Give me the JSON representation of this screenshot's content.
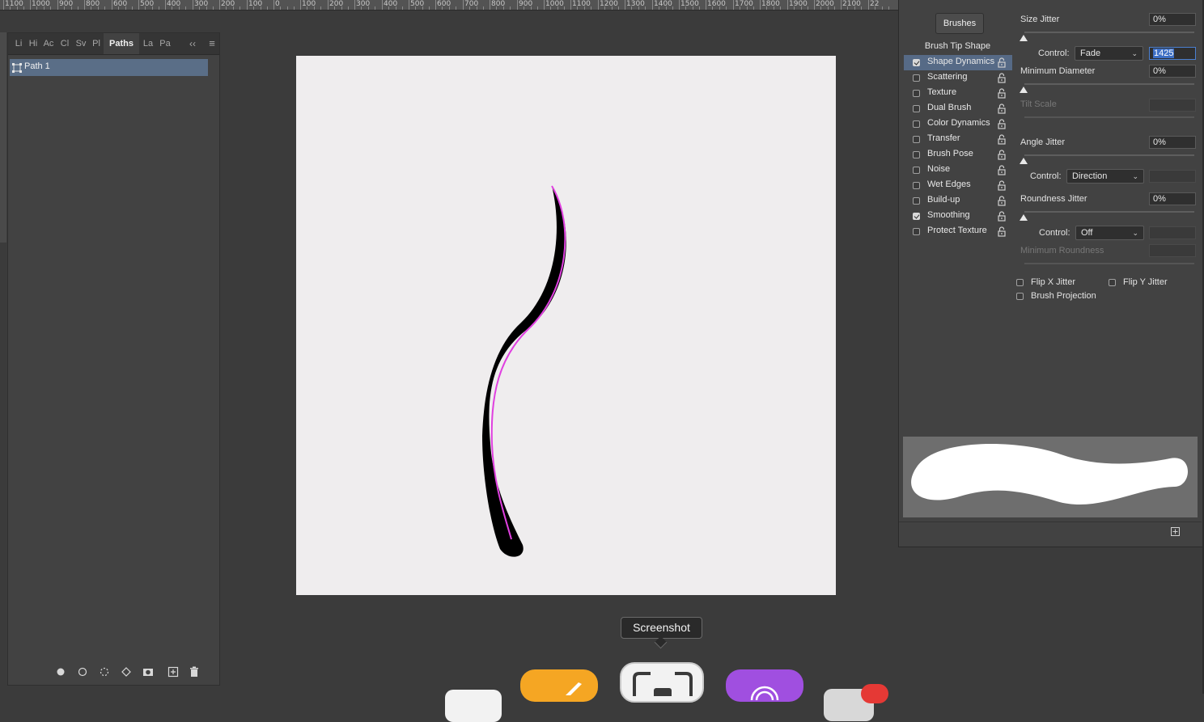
{
  "ruler": {
    "labels": [
      "1100",
      "1000",
      "900",
      "800",
      "600",
      "500",
      "400",
      "300",
      "200",
      "100",
      "0",
      "100",
      "200",
      "300",
      "400",
      "500",
      "600",
      "700",
      "800",
      "900",
      "1000",
      "1100",
      "1200",
      "1300",
      "1400",
      "1500",
      "1600",
      "1700",
      "1800",
      "1900",
      "2000",
      "2100",
      "22"
    ]
  },
  "paths_panel": {
    "tabs": [
      "Li",
      "Hi",
      "Ac",
      "Cl",
      "Sv",
      "Pl",
      "Paths",
      "La",
      "Pa"
    ],
    "active_tab": "Paths",
    "collapse_glyph": "‹‹",
    "menu_glyph": "≡",
    "path_item": "Path 1",
    "bottom_icons": [
      "fill-path-icon",
      "stroke-path-icon",
      "load-selection-icon",
      "make-work-path-icon",
      "add-mask-icon",
      "new-path-icon",
      "delete-path-icon"
    ]
  },
  "canvas": {
    "background": "#efedee",
    "stroke_color": "#000000",
    "path_color": "#e040e0"
  },
  "brush_settings": {
    "brushes_button": "Brushes",
    "tip_shape_label": "Brush Tip Shape",
    "options": [
      {
        "label": "Shape Dynamics",
        "checked": true,
        "selected": true
      },
      {
        "label": "Scattering",
        "checked": false,
        "selected": false
      },
      {
        "label": "Texture",
        "checked": false,
        "selected": false
      },
      {
        "label": "Dual Brush",
        "checked": false,
        "selected": false
      },
      {
        "label": "Color Dynamics",
        "checked": false,
        "selected": false
      },
      {
        "label": "Transfer",
        "checked": false,
        "selected": false
      },
      {
        "label": "Brush Pose",
        "checked": false,
        "selected": false
      },
      {
        "label": "Noise",
        "checked": false,
        "selected": false
      },
      {
        "label": "Wet Edges",
        "checked": false,
        "selected": false
      },
      {
        "label": "Build-up",
        "checked": false,
        "selected": false
      },
      {
        "label": "Smoothing",
        "checked": true,
        "selected": false
      },
      {
        "label": "Protect Texture",
        "checked": false,
        "selected": false
      }
    ],
    "size_jitter": {
      "label": "Size Jitter",
      "value": "0%"
    },
    "control_fade": {
      "label": "Control:",
      "value": "Fade",
      "steps": "1425"
    },
    "minimum_diameter": {
      "label": "Minimum Diameter",
      "value": "0%"
    },
    "tilt_scale": {
      "label": "Tilt Scale"
    },
    "angle_jitter": {
      "label": "Angle Jitter",
      "value": "0%"
    },
    "control_direction": {
      "label": "Control:",
      "value": "Direction"
    },
    "roundness_jitter": {
      "label": "Roundness Jitter",
      "value": "0%"
    },
    "control_off": {
      "label": "Control:",
      "value": "Off"
    },
    "minimum_roundness": {
      "label": "Minimum Roundness"
    },
    "flip_x": {
      "label": "Flip X Jitter",
      "checked": false
    },
    "flip_y": {
      "label": "Flip Y Jitter",
      "checked": false
    },
    "brush_projection": {
      "label": "Brush Projection",
      "checked": false
    },
    "new_preset_glyph": "+"
  },
  "tooltip": "Screenshot",
  "dock": {
    "icons": [
      "app-icon",
      "pencil-app-icon",
      "screenshot-app-icon",
      "podcasts-app-icon",
      "notification-app-icon"
    ],
    "colors": {
      "pencil": "#f5a623",
      "screenshot": "#e8e8e8",
      "podcasts": "#a04fe0",
      "badge": "#e53935"
    }
  }
}
